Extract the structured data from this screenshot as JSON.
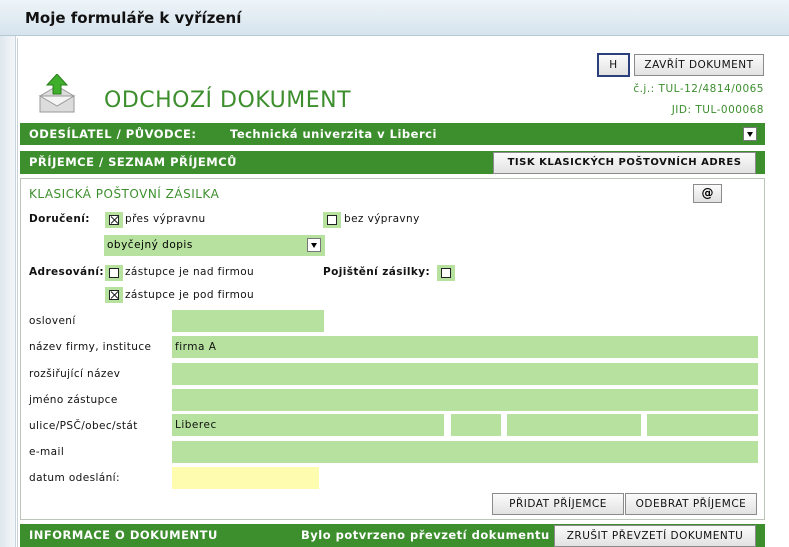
{
  "window": {
    "title": "Moje formuláře k vyřízení"
  },
  "toolbar": {
    "h_label": "H",
    "close_label": "ZAVŘÍT DOKUMENT"
  },
  "document": {
    "title": "ODCHOZÍ DOKUMENT",
    "cj": "č.j.: TUL-12/4814/0065",
    "jid": "JID: TUL-000068"
  },
  "sender": {
    "label": "ODESÍLATEL / PŮVODCE:",
    "value": "Technická univerzita v Liberci"
  },
  "recipients": {
    "label": "PŘÍJEMCE / SEZNAM PŘÍJEMCŮ",
    "print_button": "TISK KLASICKÝCH POŠTOVNÍCH ADRES"
  },
  "mail": {
    "section_title": "KLASICKÁ POŠTOVNÍ ZÁSILKA",
    "at_label": "@",
    "delivery": {
      "label": "Doručení:",
      "via_dispatch": "přes výpravnu",
      "via_dispatch_checked": true,
      "no_dispatch": "bez výpravny",
      "no_dispatch_checked": false,
      "type": "obyčejný dopis"
    },
    "addressing": {
      "label": "Adresování:",
      "rep_above": "zástupce je nad firmou",
      "rep_above_checked": false,
      "rep_below": "zástupce je pod firmou",
      "rep_below_checked": true
    },
    "insurance": {
      "label": "Pojištění zásilky:",
      "checked": false
    },
    "fields": {
      "salutation": {
        "label": "oslovení",
        "value": ""
      },
      "company": {
        "label": "název firmy, instituce",
        "value": "firma A"
      },
      "ext_name": {
        "label": "rozšiřující název",
        "value": ""
      },
      "rep_name": {
        "label": "jméno zástupce",
        "value": ""
      },
      "address": {
        "label": "ulice/PSČ/obec/stát",
        "street": "Liberec",
        "zip": "",
        "city": "",
        "country": ""
      },
      "email": {
        "label": "e-mail",
        "value": ""
      },
      "sent_date": {
        "label": "datum odeslání:",
        "value": ""
      }
    },
    "add_button": "PŘIDAT PŘÍJEMCE",
    "remove_button": "ODEBRAT PŘÍJEMCE"
  },
  "info": {
    "label": "INFORMACE O DOKUMENTU",
    "status": "Bylo potvrzeno převzetí dokumentu",
    "cancel_button": "ZRUŠIT PŘEVZETÍ DOKUMENTU"
  },
  "colors": {
    "accent": "#3d8f2e",
    "field_bg": "#b6e19e",
    "date_bg": "#fefcae"
  }
}
